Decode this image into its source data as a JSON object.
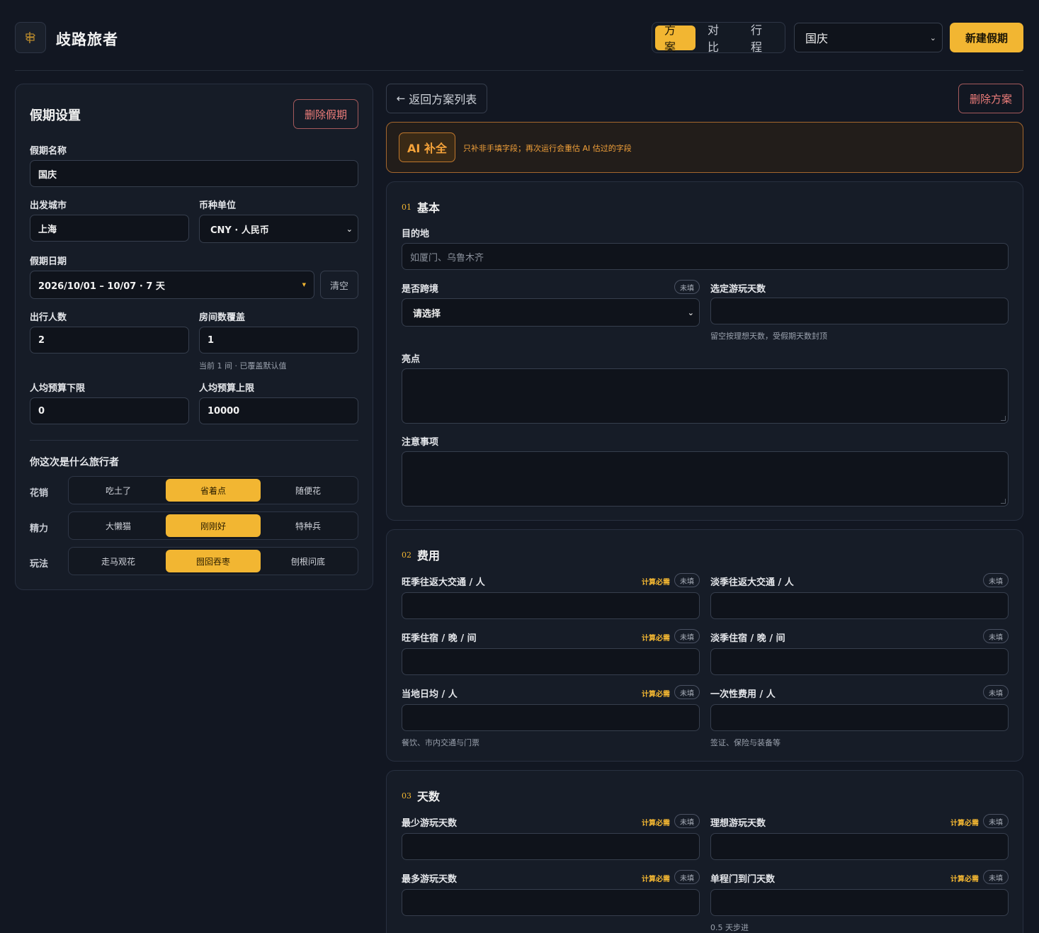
{
  "app": {
    "title": "歧路旅者",
    "logo_icon": "signpost-icon"
  },
  "header": {
    "tabs": [
      {
        "label": "方案",
        "active": true
      },
      {
        "label": "对比",
        "active": false
      },
      {
        "label": "行程",
        "active": false
      }
    ],
    "holiday_select": "国庆",
    "new_button": "新建假期"
  },
  "settings": {
    "title": "假期设置",
    "delete_button": "删除假期",
    "name_label": "假期名称",
    "name_value": "国庆",
    "city_label": "出发城市",
    "city_value": "上海",
    "currency_label": "币种单位",
    "currency_value": "CNY · 人民币",
    "date_label": "假期日期",
    "date_value": "2026/10/01 – 10/07 · 7 天",
    "clear_button": "清空",
    "people_label": "出行人数",
    "people_value": "2",
    "rooms_label": "房间数覆盖",
    "rooms_value": "1",
    "rooms_hint": "当前 1 间 · 已覆盖默认值",
    "budget_min_label": "人均预算下限",
    "budget_min_value": "0",
    "budget_max_label": "人均预算上限",
    "budget_max_value": "10000",
    "traveler_title": "你这次是什么旅行者",
    "traveler_rows": [
      {
        "label": "花销",
        "options": [
          "吃土了",
          "省着点",
          "随便花"
        ],
        "selected": 1
      },
      {
        "label": "精力",
        "options": [
          "大懒猫",
          "刚刚好",
          "特种兵"
        ],
        "selected": 1
      },
      {
        "label": "玩法",
        "options": [
          "走马观花",
          "囫囵吞枣",
          "刨根问底"
        ],
        "selected": 1
      }
    ]
  },
  "plan": {
    "back_button": "返回方案列表",
    "delete_button": "删除方案",
    "ai_button": "AI 补全",
    "ai_note": "只补非手填字段；再次运行会重估 AI 估过的字段",
    "required_badge": "计算必需",
    "empty_badge": "未填",
    "sections": {
      "basic": {
        "num": "01",
        "title": "基本",
        "destination_label": "目的地",
        "destination_placeholder": "如厦门、乌鲁木齐",
        "cross_border_label": "是否跨境",
        "cross_border_value": "请选择",
        "chosen_days_label": "选定游玩天数",
        "chosen_days_hint": "留空按理想天数，受假期天数封顶",
        "highlights_label": "亮点",
        "notes_label": "注意事项"
      },
      "cost": {
        "num": "02",
        "title": "费用",
        "peak_transport_label": "旺季往返大交通 / 人",
        "off_transport_label": "淡季往返大交通 / 人",
        "peak_hotel_label": "旺季住宿 / 晚 / 间",
        "off_hotel_label": "淡季住宿 / 晚 / 间",
        "daily_label": "当地日均 / 人",
        "daily_hint": "餐饮、市内交通与门票",
        "oneoff_label": "一次性费用 / 人",
        "oneoff_hint": "签证、保险与装备等"
      },
      "days": {
        "num": "03",
        "title": "天数",
        "min_label": "最少游玩天数",
        "ideal_label": "理想游玩天数",
        "max_label": "最多游玩天数",
        "door_label": "单程门到门天数",
        "door_hint": "0.5 天步进"
      }
    }
  }
}
